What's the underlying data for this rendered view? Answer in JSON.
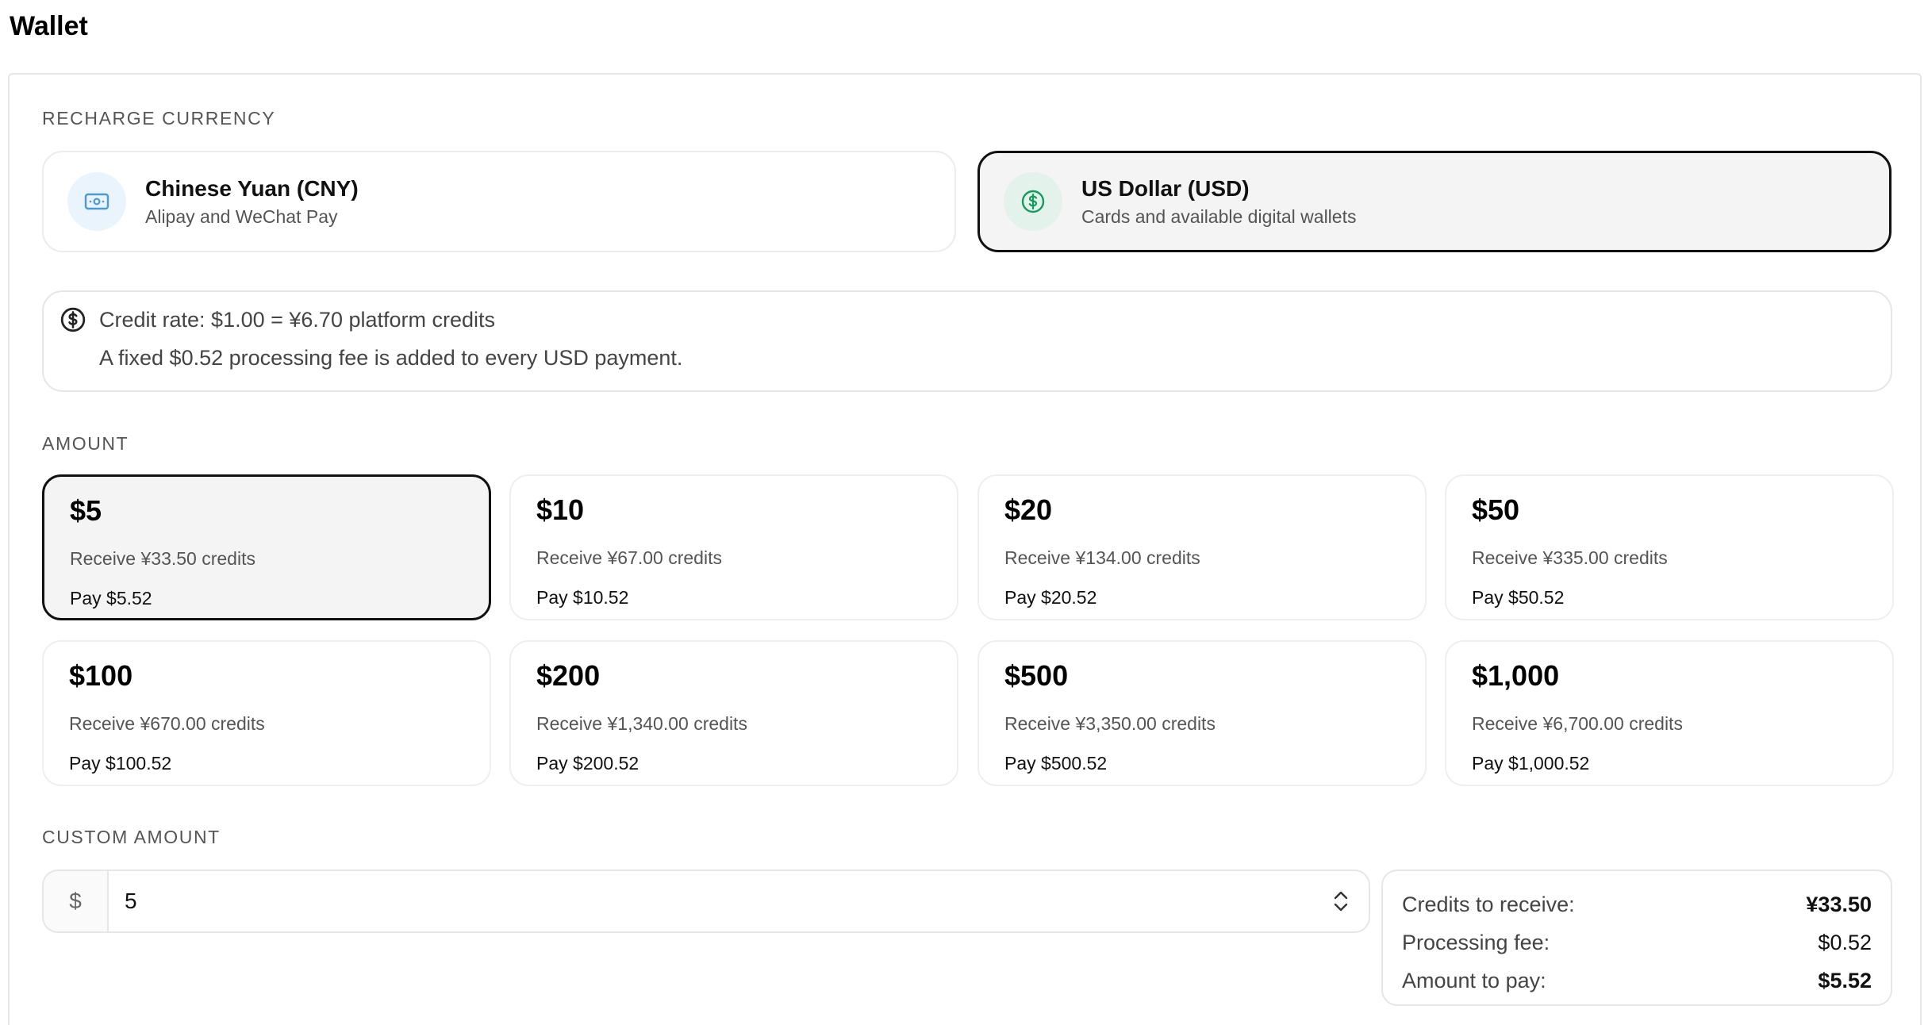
{
  "page": {
    "title": "Wallet"
  },
  "sections": {
    "currency_label": "RECHARGE CURRENCY",
    "amount_label": "AMOUNT",
    "custom_label": "CUSTOM AMOUNT"
  },
  "currencies": [
    {
      "name": "Chinese Yuan (CNY)",
      "sub": "Alipay and WeChat Pay",
      "icon": "banknote-icon",
      "selected": false
    },
    {
      "name": "US Dollar (USD)",
      "sub": "Cards and available digital wallets",
      "icon": "dollar-circle-icon",
      "selected": true
    }
  ],
  "info": {
    "line1": "Credit rate: $1.00 = ¥6.70 platform credits",
    "line2": "A fixed $0.52 processing fee is added to every USD payment.",
    "icon": "dollar-circle-icon"
  },
  "amounts": [
    {
      "value": "$5",
      "receive": "Receive ¥33.50 credits",
      "pay": "Pay $5.52",
      "selected": true
    },
    {
      "value": "$10",
      "receive": "Receive ¥67.00 credits",
      "pay": "Pay $10.52",
      "selected": false
    },
    {
      "value": "$20",
      "receive": "Receive ¥134.00 credits",
      "pay": "Pay $20.52",
      "selected": false
    },
    {
      "value": "$50",
      "receive": "Receive ¥335.00 credits",
      "pay": "Pay $50.52",
      "selected": false
    },
    {
      "value": "$100",
      "receive": "Receive ¥670.00 credits",
      "pay": "Pay $100.52",
      "selected": false
    },
    {
      "value": "$200",
      "receive": "Receive ¥1,340.00 credits",
      "pay": "Pay $200.52",
      "selected": false
    },
    {
      "value": "$500",
      "receive": "Receive ¥3,350.00 credits",
      "pay": "Pay $500.52",
      "selected": false
    },
    {
      "value": "$1,000",
      "receive": "Receive ¥6,700.00 credits",
      "pay": "Pay $1,000.52",
      "selected": false
    }
  ],
  "custom": {
    "prefix": "$",
    "value": "5",
    "stepper_icon": "chevron-up-down-icon"
  },
  "summary": {
    "credits_label": "Credits to receive:",
    "credits_value": "¥33.50",
    "fee_label": "Processing fee:",
    "fee_value": "$0.52",
    "pay_label": "Amount to pay:",
    "pay_value": "$5.52"
  },
  "colors": {
    "selected_border": "#111111",
    "selected_bg": "#f4f4f4",
    "cny_icon": "#4a9ad6",
    "cny_icon_bg": "#eaf4fd",
    "usd_icon": "#169a5e",
    "usd_icon_bg": "#e3f2ea"
  }
}
